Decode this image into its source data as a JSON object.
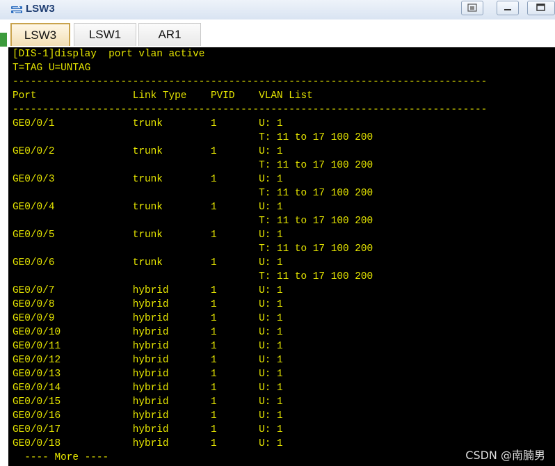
{
  "window": {
    "title": "LSW3",
    "icon": "network-switch-icon",
    "buttons": [
      "restore-icon",
      "minimize-icon",
      "maximize-icon"
    ]
  },
  "tabs": [
    {
      "label": "LSW3",
      "active": true
    },
    {
      "label": "LSW1",
      "active": false
    },
    {
      "label": "AR1",
      "active": false
    }
  ],
  "terminal": {
    "colors": {
      "background": "#000000",
      "text": "#e6e600"
    },
    "lines": [
      "[DIS-1]display  port vlan active",
      "T=TAG U=UNTAG",
      "-------------------------------------------------------------------------------",
      "Port                Link Type    PVID    VLAN List",
      "-------------------------------------------------------------------------------",
      "GE0/0/1             trunk        1       U: 1",
      "                                         T: 11 to 17 100 200",
      "GE0/0/2             trunk        1       U: 1",
      "                                         T: 11 to 17 100 200",
      "GE0/0/3             trunk        1       U: 1",
      "                                         T: 11 to 17 100 200",
      "GE0/0/4             trunk        1       U: 1",
      "                                         T: 11 to 17 100 200",
      "GE0/0/5             trunk        1       U: 1",
      "                                         T: 11 to 17 100 200",
      "GE0/0/6             trunk        1       U: 1",
      "                                         T: 11 to 17 100 200",
      "GE0/0/7             hybrid       1       U: 1",
      "GE0/0/8             hybrid       1       U: 1",
      "GE0/0/9             hybrid       1       U: 1",
      "GE0/0/10            hybrid       1       U: 1",
      "GE0/0/11            hybrid       1       U: 1",
      "GE0/0/12            hybrid       1       U: 1",
      "GE0/0/13            hybrid       1       U: 1",
      "GE0/0/14            hybrid       1       U: 1",
      "GE0/0/15            hybrid       1       U: 1",
      "GE0/0/16            hybrid       1       U: 1",
      "GE0/0/17            hybrid       1       U: 1",
      "GE0/0/18            hybrid       1       U: 1",
      "  ---- More ----"
    ]
  },
  "watermark": "CSDN @南腩男"
}
